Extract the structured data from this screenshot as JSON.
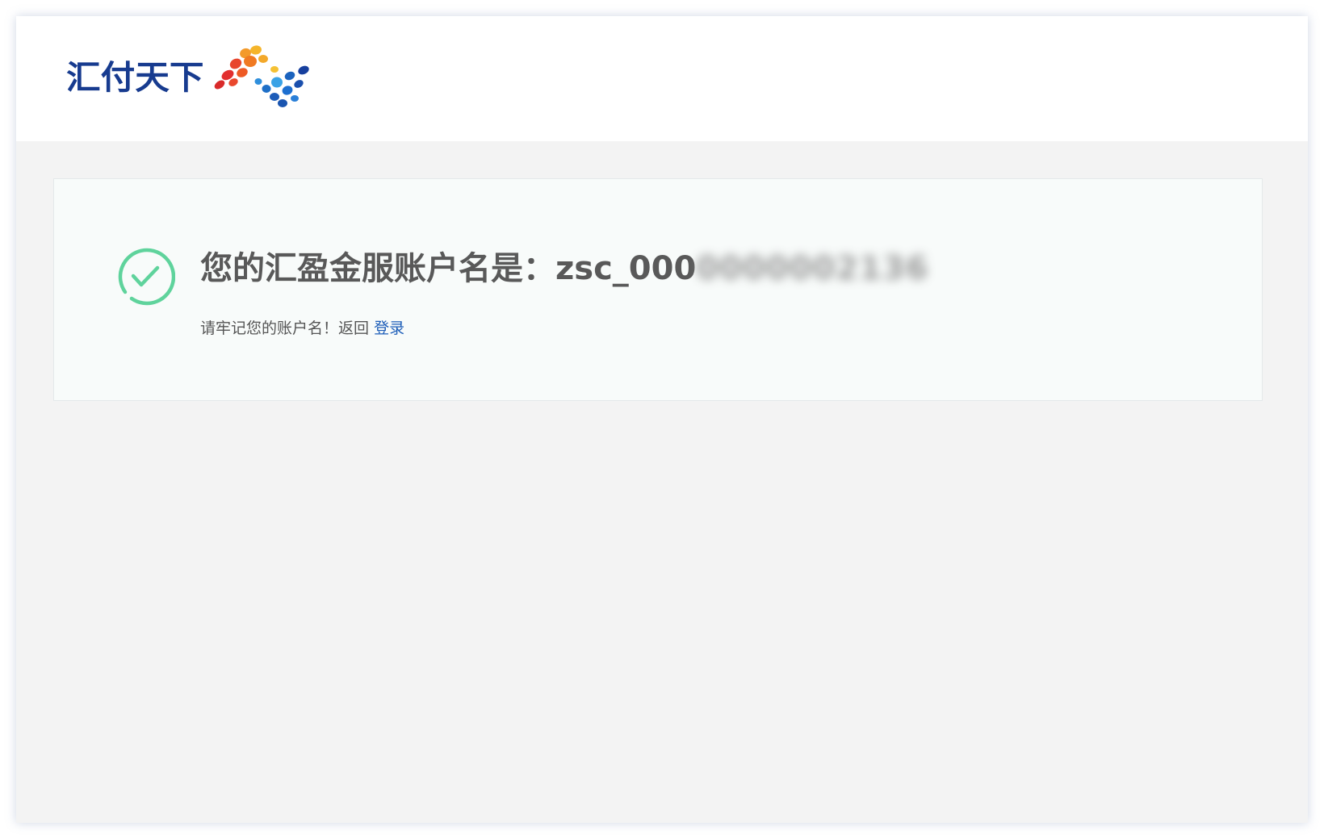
{
  "header": {
    "logo_text": "汇付天下",
    "logo_icon": "huifu-dots-logo"
  },
  "result": {
    "icon": "check-circle-icon",
    "success_color": "#5fd39c",
    "headline_label": "您的汇盈金服账户名是：",
    "account_visible": "zsc_000",
    "account_masked": "0000002136",
    "hint_text": "请牢记您的账户名！返回",
    "login_link": "登录",
    "link_color": "#1c5db8"
  }
}
